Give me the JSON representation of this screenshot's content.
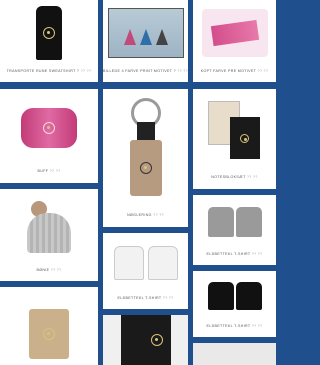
{
  "products": [
    {
      "name": "TRANSPORTE RUNE SWEATSHIRT ?",
      "price": "?? ??"
    },
    {
      "name": "BILLEDE 4 FARVE PRINT MOTIVET ?",
      "price": "?? ??"
    },
    {
      "name": "KOPT FARVE PRE MOTIVET",
      "price": "?? ??"
    },
    {
      "name": "BUFF",
      "price": "?? ??"
    },
    {
      "name": "NØGLERING",
      "price": "?? ??"
    },
    {
      "name": "NOTESBLOKSÆT",
      "price": "?? ??"
    },
    {
      "name": "BØNIE",
      "price": "?? ??"
    },
    {
      "name": "ELDBETTEKL T-SHIRT",
      "price": "?? ??"
    },
    {
      "name": "ELDBETTEKL T-SHIRT",
      "price": "?? ??"
    },
    {
      "name": "ELDBETTEKL T-SHIRT",
      "price": "?? ??"
    },
    {
      "name": "",
      "price": ""
    },
    {
      "name": "",
      "price": ""
    },
    {
      "name": "",
      "price": ""
    }
  ],
  "colors": {
    "background": "#1f4f8c",
    "card": "#ffffff",
    "gold": "#d9c37a",
    "pink": "#d44d8c"
  },
  "icons": [
    "star-emblem-icon"
  ]
}
